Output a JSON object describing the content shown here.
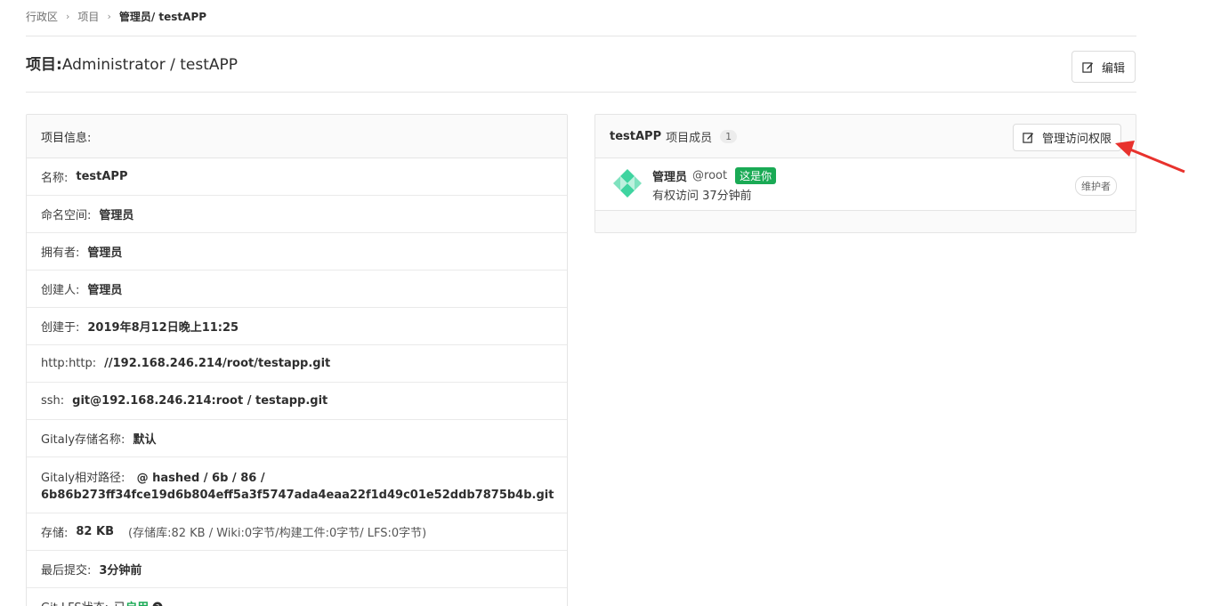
{
  "breadcrumb": {
    "items": [
      "行政区",
      "项目"
    ],
    "current": "管理员/ testAPP"
  },
  "header": {
    "title_label": "项目:",
    "title_value": "Administrator / testAPP",
    "edit_label": "编辑"
  },
  "info_panel": {
    "title": "项目信息:",
    "rows": [
      {
        "key": "名称:",
        "value": "testAPP"
      },
      {
        "key": "命名空间:",
        "value": "管理员"
      },
      {
        "key": "拥有者:",
        "value": "管理员"
      },
      {
        "key": "创建人:",
        "value": "管理员"
      },
      {
        "key": "创建于:",
        "value": "2019年8月12日晚上11:25"
      },
      {
        "key": "http:http:",
        "value": "//192.168.246.214/root/testapp.git"
      },
      {
        "key": "ssh:",
        "value": "git@192.168.246.214:root / testapp.git"
      },
      {
        "key": "Gitaly存储名称:",
        "value": "默认"
      }
    ],
    "gitaly_path": {
      "key": "Gitaly相对路径:",
      "value_line1": "@ hashed / 6b / 86 /",
      "value_line2": "6b86b273ff34fce19d6b804eff5a3f5747ada4eaa22f1d49c01e52ddb7875b4b.git"
    },
    "storage": {
      "key": "存储:",
      "value": "82 KB",
      "detail": "(存储库:82 KB / Wiki:0字节/构建工件:0字节/ LFS:0字节)"
    },
    "last_commit": {
      "key": "最后提交:",
      "value": "3分钟前"
    },
    "lfs": {
      "key": "Git LFS状态:",
      "prefix": "已",
      "value": "启用",
      "help_icon": "question-circle-icon"
    }
  },
  "members_panel": {
    "project": "testAPP",
    "label": "项目成员",
    "count": "1",
    "manage_label": "管理访问权限",
    "member": {
      "name": "管理员",
      "username": "@root",
      "you_badge": "这是你",
      "access": "有权访问 37分钟前",
      "role": "维护者"
    }
  },
  "colors": {
    "accent_green": "#1aaa55",
    "annotation_red": "#e8322d",
    "avatar_teal": "#3fd4a0"
  }
}
